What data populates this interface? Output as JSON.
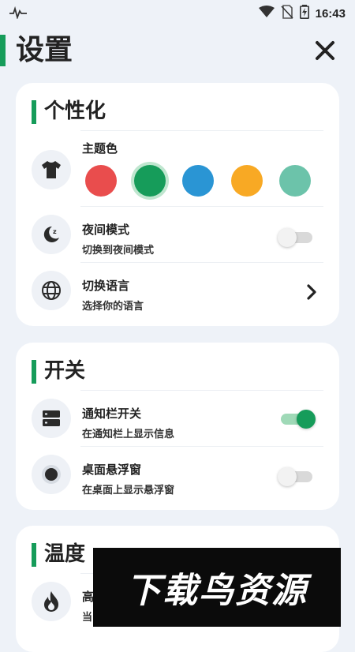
{
  "status_bar": {
    "time": "16:43"
  },
  "header": {
    "title": "设置"
  },
  "personalization": {
    "title": "个性化",
    "theme": {
      "label": "主题色",
      "colors": [
        "#e94d4d",
        "#169c5a",
        "#2a95d4",
        "#f8a924",
        "#6cc3aa"
      ],
      "selected_color": "#169c5a"
    },
    "night_mode": {
      "title": "夜间模式",
      "subtitle": "切换到夜间模式",
      "enabled": false
    },
    "language": {
      "title": "切换语言",
      "subtitle": "选择你的语言"
    }
  },
  "switches": {
    "title": "开关",
    "notification_bar": {
      "title": "通知栏开关",
      "subtitle": "在通知栏上显示信息",
      "enabled": true
    },
    "floating_window": {
      "title": "桌面悬浮窗",
      "subtitle": "在桌面上显示悬浮窗",
      "enabled": false
    }
  },
  "temperature": {
    "title": "温度",
    "item": {
      "title": "高",
      "subtitle": "当"
    }
  },
  "watermark": {
    "text": "下载鸟资源"
  }
}
